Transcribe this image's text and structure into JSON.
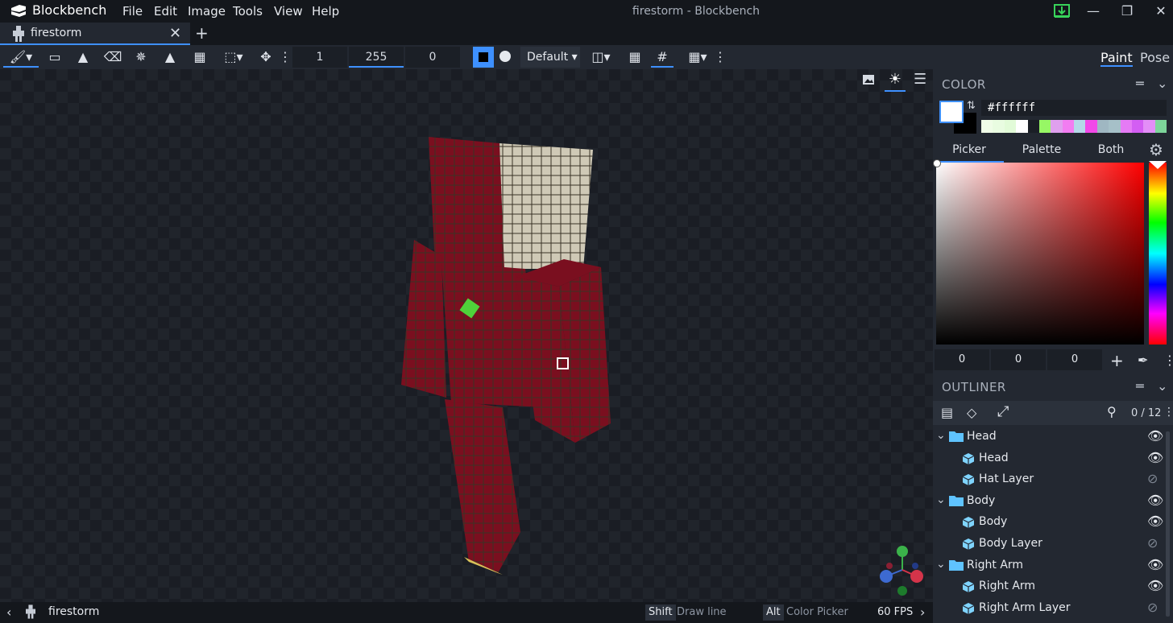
{
  "window": {
    "app_name": "Blockbench",
    "title": "firestorm - Blockbench",
    "menu": [
      "File",
      "Edit",
      "Image",
      "Tools",
      "View",
      "Help"
    ]
  },
  "tabs": [
    {
      "label": "firestorm"
    }
  ],
  "toolbar": {
    "brush_size": "1",
    "opacity": "255",
    "softness": "0",
    "brush_mode": "Default",
    "modes": {
      "paint": "Paint",
      "pose": "Pose"
    }
  },
  "color_panel": {
    "title": "COLOR",
    "hex": "#ffffff",
    "tabs": [
      "Picker",
      "Palette",
      "Both"
    ],
    "rgb": [
      "0",
      "0",
      "0"
    ],
    "palette": [
      "#f0fde8",
      "#e9fce1",
      "#e2fbd8",
      "#ffffff",
      "#1b1f26",
      "#97f765",
      "#dfa0ee",
      "#f27df1",
      "#b4d8e8",
      "#f249e8",
      "#9fb7c2",
      "#a6c0c8",
      "#e57bf5",
      "#d35ef3",
      "#e38ef7",
      "#7dd59a"
    ]
  },
  "outliner": {
    "title": "OUTLINER",
    "count": "0 / 12",
    "items": [
      {
        "label": "Head",
        "type": "group",
        "visible": true
      },
      {
        "label": "Head",
        "type": "cube",
        "visible": true
      },
      {
        "label": "Hat Layer",
        "type": "cube",
        "visible": false
      },
      {
        "label": "Body",
        "type": "group",
        "visible": true
      },
      {
        "label": "Body",
        "type": "cube",
        "visible": true
      },
      {
        "label": "Body Layer",
        "type": "cube",
        "visible": false
      },
      {
        "label": "Right Arm",
        "type": "group",
        "visible": true
      },
      {
        "label": "Right Arm",
        "type": "cube",
        "visible": true
      },
      {
        "label": "Right Arm Layer",
        "type": "cube",
        "visible": false
      }
    ]
  },
  "statusbar": {
    "project": "firestorm",
    "hints": [
      {
        "key": "Shift",
        "text": "Draw line"
      },
      {
        "key": "Alt",
        "text": "Color Picker"
      }
    ],
    "fps": "60 FPS"
  },
  "colors": {
    "accent": "#3e90ff",
    "folder": "#5fc3ff",
    "cube": "#7fd4ff"
  }
}
